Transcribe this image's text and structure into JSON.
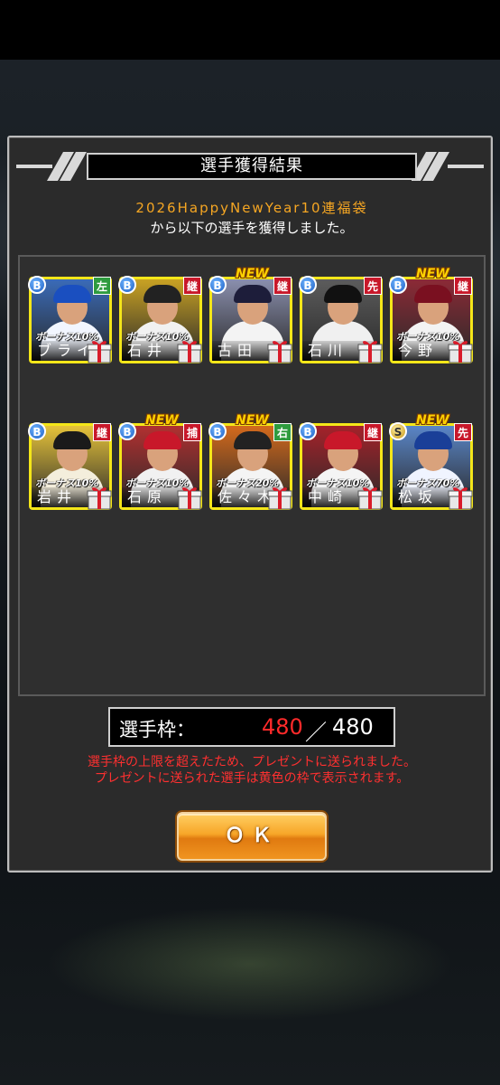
{
  "dialog": {
    "title": "選手獲得結果",
    "message_line1": "2026HappyNewYear10連福袋",
    "message_line2": "から以下の選手を獲得しました。"
  },
  "players": [
    {
      "name": "ブライ",
      "rank": "B",
      "position": "左",
      "pos_color": "green",
      "bonus": "ボーナス10%",
      "new": "",
      "cap": "#1a4fc0",
      "body": "#f2f6ff",
      "bg": "#3a6bb8"
    },
    {
      "name": "石井",
      "rank": "B",
      "position": "継",
      "pos_color": "red",
      "bonus": "ボーナス10%",
      "new": "",
      "cap": "#222222",
      "body": "#f1f1f1",
      "bg": "#c9a223"
    },
    {
      "name": "古田",
      "rank": "B",
      "position": "継",
      "pos_color": "red",
      "bonus": "",
      "new": "NEW",
      "cap": "#1d1d3a",
      "body": "#f3f3f3",
      "bg": "#8a8fae"
    },
    {
      "name": "石川",
      "rank": "B",
      "position": "先",
      "pos_color": "red",
      "bonus": "",
      "new": "",
      "cap": "#111111",
      "body": "#f0f0f0",
      "bg": "#5c5c5c"
    },
    {
      "name": "今野",
      "rank": "B",
      "position": "継",
      "pos_color": "red",
      "bonus": "ボーナス10%",
      "new": "NEW",
      "cap": "#7a1020",
      "body": "#f3f3f3",
      "bg": "#8c2a36"
    },
    {
      "name": "岩井",
      "rank": "B",
      "position": "継",
      "pos_color": "red",
      "bonus": "ボーナス10%",
      "new": "",
      "cap": "#1a1a1a",
      "body": "#f4eedc",
      "bg": "#e6c33a"
    },
    {
      "name": "石原",
      "rank": "B",
      "position": "捕",
      "pos_color": "red",
      "bonus": "ボーナス10%",
      "new": "NEW",
      "cap": "#c8182a",
      "body": "#f1f1f1",
      "bg": "#b23030"
    },
    {
      "name": "佐々木",
      "rank": "B",
      "position": "右",
      "pos_color": "green",
      "bonus": "ボーナス20%",
      "new": "NEW",
      "cap": "#222222",
      "body": "#f4f4f4",
      "bg": "#d46a1c"
    },
    {
      "name": "中崎",
      "rank": "B",
      "position": "継",
      "pos_color": "red",
      "bonus": "ボーナス10%",
      "new": "",
      "cap": "#c8182a",
      "body": "#f4f4f4",
      "bg": "#a5222a"
    },
    {
      "name": "松坂",
      "rank": "S",
      "position": "先",
      "pos_color": "red",
      "bonus": "ボーナス70%",
      "new": "NEW",
      "cap": "#1a3f98",
      "body": "#f0f4ff",
      "bg": "#5a86c8"
    }
  ],
  "roster": {
    "label": "選手枠：",
    "current": "480",
    "separator": "／",
    "max": "480"
  },
  "warning": {
    "line1": "選手枠の上限を超えたため、プレゼントに送られました。",
    "line2": "プレゼントに送られた選手は黄色の枠で表示されます。"
  },
  "ok_button": "ＯＫ",
  "colors": {
    "card_frame": "#f4e619",
    "accent_orange": "#f5a623",
    "warning_red": "#ff3030"
  }
}
